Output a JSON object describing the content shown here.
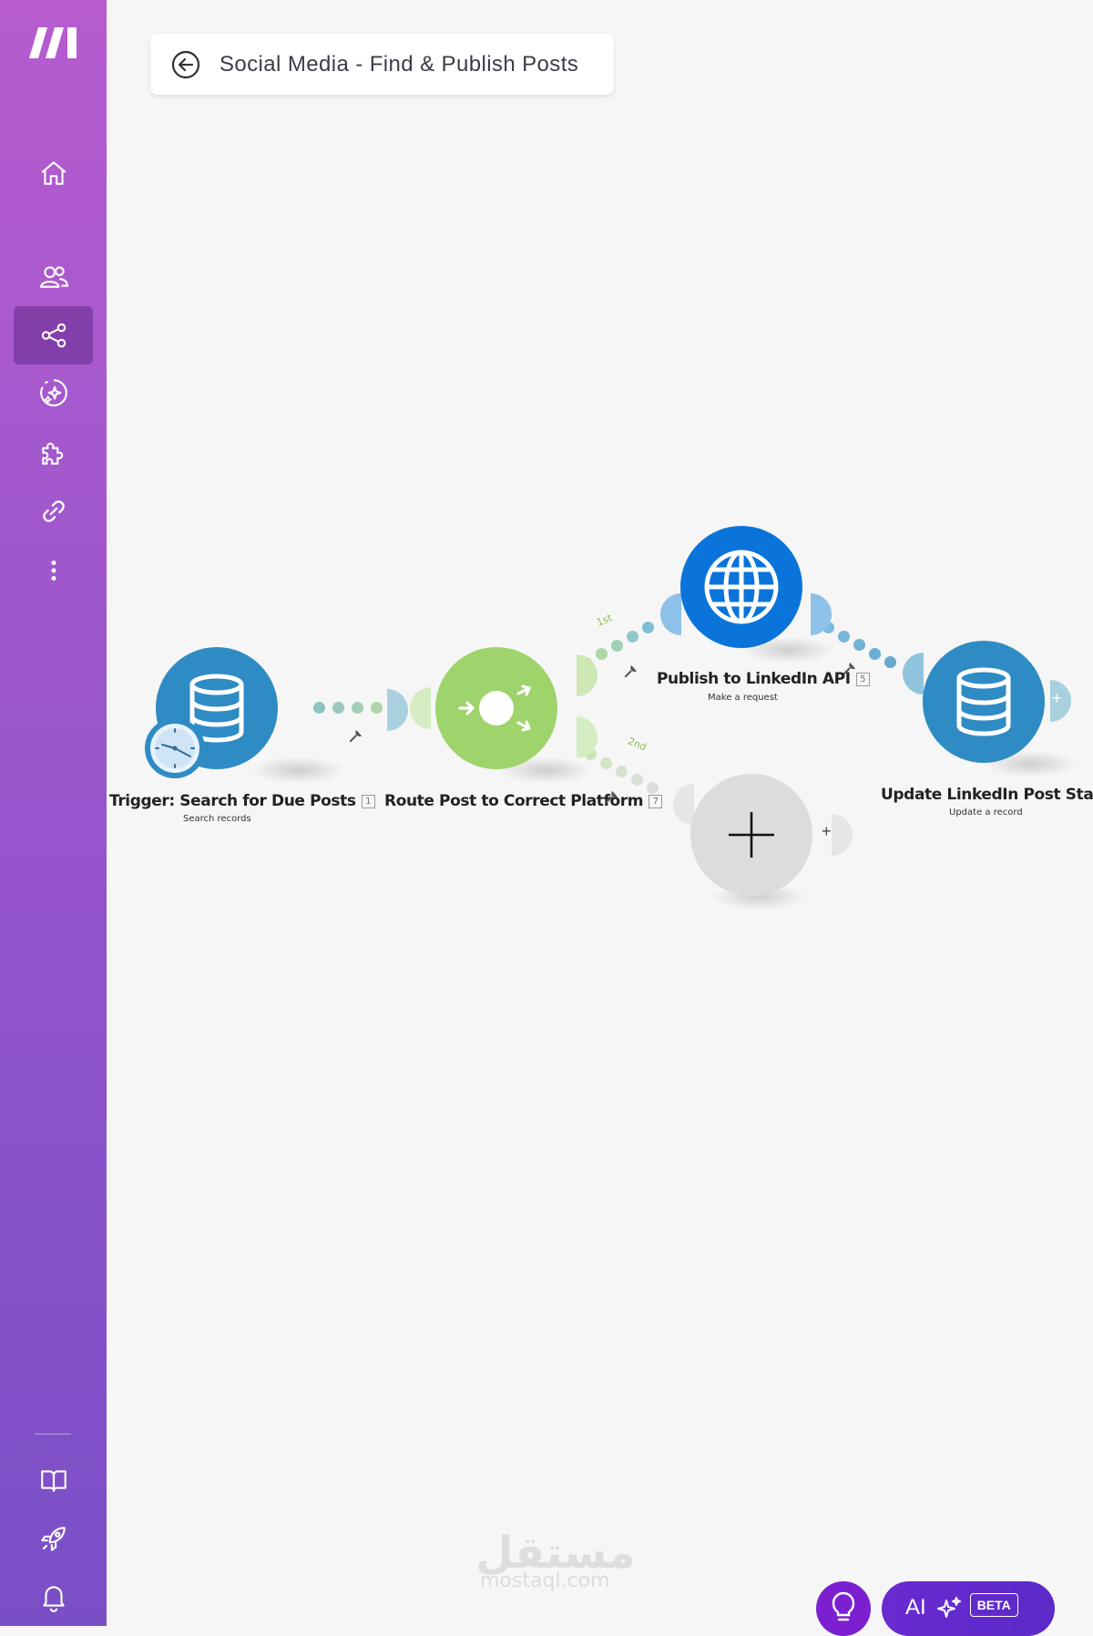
{
  "colors": {
    "sidebar_top": "#b65ccf",
    "sidebar_bottom": "#7a4fc6",
    "datastore_blue": "#2f8bc4",
    "router_green": "#9fd36b",
    "http_blue": "#0a74da",
    "placeholder_gray": "#dcdcdc",
    "ai_purple": "#6a2ad1"
  },
  "sidebar": {
    "items": [
      {
        "name": "home",
        "icon": "home-icon",
        "active": false
      },
      {
        "name": "team",
        "icon": "team-icon",
        "active": false
      },
      {
        "name": "scenarios",
        "icon": "share-icon",
        "active": true
      },
      {
        "name": "ai-agents",
        "icon": "sparkle-circle-icon",
        "active": false
      },
      {
        "name": "apps",
        "icon": "puzzle-icon",
        "active": false
      },
      {
        "name": "connections",
        "icon": "link-icon",
        "active": false
      },
      {
        "name": "more",
        "icon": "more-vertical-icon",
        "active": false
      }
    ],
    "bottom_items": [
      {
        "name": "docs",
        "icon": "book-icon"
      },
      {
        "name": "whats-new",
        "icon": "rocket-icon"
      },
      {
        "name": "notifications",
        "icon": "bell-icon"
      }
    ]
  },
  "header": {
    "title": "Social Media - Find & Publish Posts"
  },
  "scenario": {
    "modules": [
      {
        "title": "Trigger: Search for Due Posts",
        "badge": "1",
        "subtitle": "Search records",
        "icon": "database-icon"
      },
      {
        "title": "Route Post to Correct Platform",
        "badge": "7",
        "subtitle": "",
        "icon": "router-icon"
      },
      {
        "title": "Publish to LinkedIn API",
        "badge": "5",
        "subtitle": "Make a request",
        "icon": "globe-icon"
      },
      {
        "title": "Update LinkedIn Post Status",
        "badge": "",
        "subtitle": "Update a record",
        "icon": "database-icon"
      }
    ],
    "routes": [
      {
        "label": "1st"
      },
      {
        "label": "2nd"
      }
    ],
    "add_module": {
      "icon": "plus-icon"
    }
  },
  "watermark": {
    "arabic": "مستقل",
    "latin": "mostaql.com"
  },
  "bottom_bar": {
    "ai_label": "AI",
    "beta_label": "BETA"
  }
}
